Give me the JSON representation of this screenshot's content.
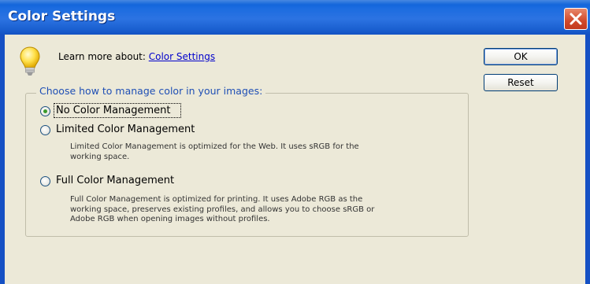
{
  "window": {
    "title": "Color Settings"
  },
  "info": {
    "prefix": "Learn more about:",
    "link": "Color Settings"
  },
  "buttons": {
    "ok": "OK",
    "reset": "Reset"
  },
  "group": {
    "legend": "Choose how to manage color in your images:",
    "options": [
      {
        "label": "No Color Management",
        "selected": true,
        "description": ""
      },
      {
        "label": "Limited Color Management",
        "selected": false,
        "description_lines": [
          "Limited Color Management is optimized for the Web. It uses sRGB for the",
          "working space."
        ]
      },
      {
        "label": "Full Color Management",
        "selected": false,
        "description_lines": [
          "Full Color Management is optimized for printing. It uses Adobe RGB as the",
          "working space, preserves existing profiles, and allows you to choose sRGB or",
          "Adobe RGB when opening images without profiles."
        ]
      }
    ]
  },
  "colors": {
    "titlebar": "#1c6ce0",
    "close_button": "#d1492b",
    "dialog_bg": "#ece9d8",
    "legend_text": "#1f4fb5",
    "link": "#0000cc",
    "radio_selected": "#3b9a2b"
  },
  "icons": {
    "info": "lightbulb-icon",
    "close": "close-icon"
  }
}
